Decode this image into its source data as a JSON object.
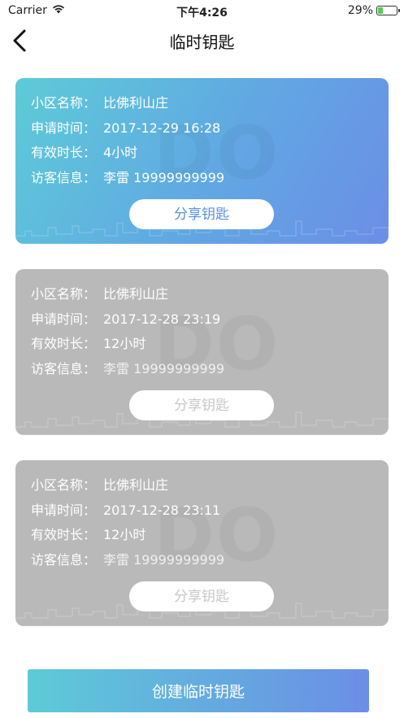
{
  "status": {
    "carrier": "Carrier",
    "time": "下午4:26",
    "battery_text": "29%",
    "battery_level": 0.29
  },
  "nav": {
    "title": "临时钥匙"
  },
  "cards": [
    {
      "rows": [
        {
          "label": "小区名称：",
          "value": "比佛利山庄"
        },
        {
          "label": "申请时间：",
          "value": "2017-12-29 16:28"
        },
        {
          "label": "有效时长：",
          "value": "4小时"
        },
        {
          "label": "访客信息：",
          "value": "李雷 19999999999"
        }
      ],
      "share_label": "分享钥匙",
      "active": true
    },
    {
      "rows": [
        {
          "label": "小区名称：",
          "value": "比佛利山庄"
        },
        {
          "label": "申请时间：",
          "value": "2017-12-28 23:19"
        },
        {
          "label": "有效时长：",
          "value": "12小时"
        },
        {
          "label": "访客信息：",
          "value": "李雷 19999999999"
        }
      ],
      "share_label": "分享钥匙",
      "active": false
    },
    {
      "rows": [
        {
          "label": "小区名称：",
          "value": "比佛利山庄"
        },
        {
          "label": "申请时间：",
          "value": "2017-12-28 23:11"
        },
        {
          "label": "有效时长：",
          "value": "12小时"
        },
        {
          "label": "访客信息：",
          "value": "李雷 19999999999"
        }
      ],
      "share_label": "分享钥匙",
      "active": false
    }
  ],
  "create_button": "创建临时钥匙",
  "colors": {
    "accent_start": "#5dcbd7",
    "accent_end": "#6b8ee6",
    "inactive_card": "#b9b9b9"
  }
}
